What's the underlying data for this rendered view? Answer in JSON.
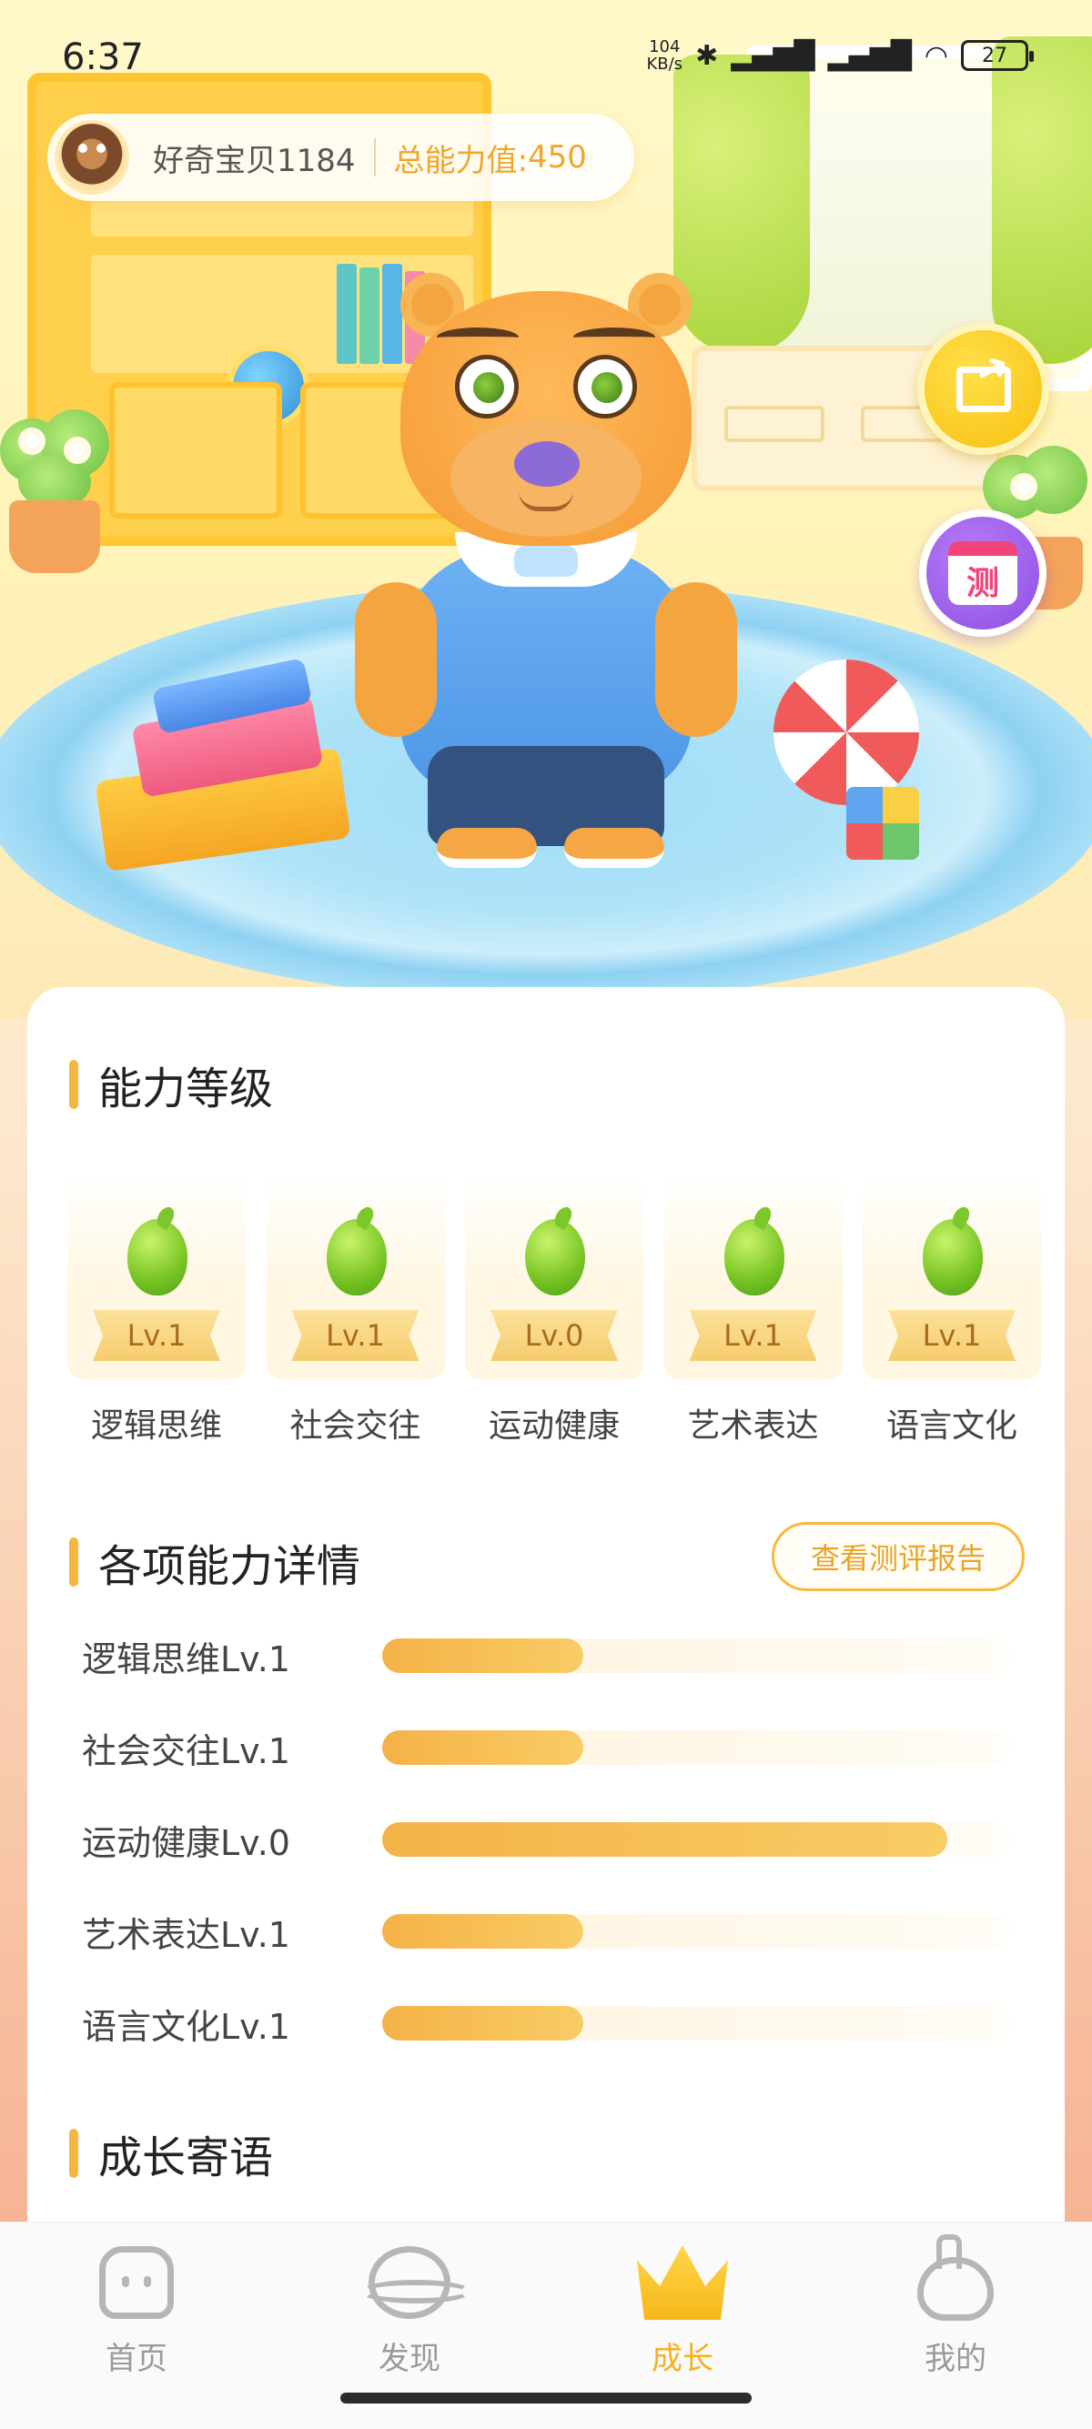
{
  "status_bar": {
    "time": "6:37",
    "net_speed_value": "104",
    "net_speed_unit": "KB/s",
    "battery": "27",
    "icons": [
      "bluetooth-icon",
      "hd-signal-icon",
      "hd-signal-icon",
      "wifi-icon",
      "battery-icon"
    ]
  },
  "user": {
    "name": "好奇宝贝1184",
    "power_label": "总能力值: ",
    "power_value": "450"
  },
  "actions": {
    "share_icon": "share-icon",
    "test_badge": "测"
  },
  "levels_section": {
    "title": "能力等级",
    "items": [
      {
        "level": "Lv.1",
        "name": "逻辑思维"
      },
      {
        "level": "Lv.1",
        "name": "社会交往"
      },
      {
        "level": "Lv.0",
        "name": "运动健康"
      },
      {
        "level": "Lv.1",
        "name": "艺术表达"
      },
      {
        "level": "Lv.1",
        "name": "语言文化"
      }
    ]
  },
  "details_section": {
    "title": "各项能力详情",
    "report_button": "查看测评报告",
    "rows": [
      {
        "label": "逻辑思维Lv.1",
        "progress": 0.32
      },
      {
        "label": "社会交往Lv.1",
        "progress": 0.32
      },
      {
        "label": "运动健康Lv.0",
        "progress": 0.9
      },
      {
        "label": "艺术表达Lv.1",
        "progress": 0.32
      },
      {
        "label": "语言文化Lv.1",
        "progress": 0.32
      }
    ]
  },
  "growth_section": {
    "title": "成长寄语"
  },
  "bottom_nav": {
    "items": [
      {
        "label": "首页",
        "icon": "home-icon",
        "active": false
      },
      {
        "label": "发现",
        "icon": "discover-icon",
        "active": false
      },
      {
        "label": "成长",
        "icon": "crown-icon",
        "active": true
      },
      {
        "label": "我的",
        "icon": "profile-icon",
        "active": false
      }
    ]
  },
  "colors": {
    "accent": "#f6b440",
    "active_nav": "#f5b01e",
    "progress_fill": "#f4b247"
  }
}
